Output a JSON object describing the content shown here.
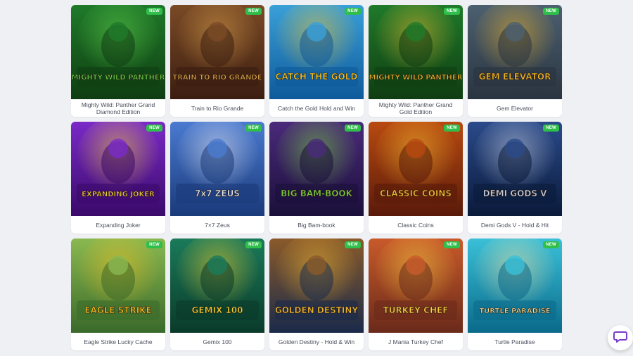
{
  "games": [
    {
      "title": "Mighty Wild: Panther Grand Diamond Edition",
      "badge": "NEW",
      "art_title": "MIGHTY WILD PANTHER",
      "colors": [
        "#0f3d12",
        "#1f7a2a",
        "#62d04a"
      ]
    },
    {
      "title": "Train to Rio Grande",
      "badge": "NEW",
      "art_title": "TRAIN TO RIO GRANDE",
      "colors": [
        "#3b1d10",
        "#7a4a26",
        "#d8a04a"
      ]
    },
    {
      "title": "Catch the Gold Hold and Win",
      "badge": "NEW",
      "art_title": "CATCH THE GOLD",
      "colors": [
        "#0e5a9a",
        "#3aa0d8",
        "#f2c530"
      ]
    },
    {
      "title": "Mighty Wild: Panther Grand Gold Edition",
      "badge": "NEW",
      "art_title": "MIGHTY WILD PANTHER",
      "colors": [
        "#0f3d12",
        "#1f7a2a",
        "#e8b830"
      ]
    },
    {
      "title": "Gem Elevator",
      "badge": "NEW",
      "art_title": "GEM ELEVATOR",
      "colors": [
        "#2a3440",
        "#4c6070",
        "#f0b428"
      ]
    },
    {
      "title": "Expanding Joker",
      "badge": "NEW",
      "art_title": "EXPANDING JOKER",
      "colors": [
        "#3a0a6a",
        "#7a2ac8",
        "#f4d040"
      ]
    },
    {
      "title": "7×7 Zeus",
      "badge": "NEW",
      "art_title": "7x7 ZEUS",
      "colors": [
        "#1a3a7a",
        "#4a7ad0",
        "#e8e8f0"
      ]
    },
    {
      "title": "Big Bam-book",
      "badge": "NEW",
      "art_title": "BIG BAM-BOOK",
      "colors": [
        "#1a0f3a",
        "#4a2a7a",
        "#7ad040"
      ]
    },
    {
      "title": "Classic Coins",
      "badge": "NEW",
      "art_title": "CLASSIC COINS",
      "colors": [
        "#5a1a0a",
        "#b84a10",
        "#f8c030"
      ]
    },
    {
      "title": "Demi Gods V - Hold & Hit",
      "badge": "NEW",
      "art_title": "DEMI GODS V",
      "colors": [
        "#0a1a3a",
        "#2a4a8a",
        "#c8d0e0"
      ]
    },
    {
      "title": "Eagle Strike Lucky Cache",
      "badge": "NEW",
      "art_title": "EAGLE STRIKE",
      "colors": [
        "#3a6a2a",
        "#8ab850",
        "#f4c020"
      ]
    },
    {
      "title": "Gemix 100",
      "badge": "NEW",
      "art_title": "GEMIX 100",
      "colors": [
        "#0a3a2a",
        "#1a7a5a",
        "#f0d030"
      ]
    },
    {
      "title": "Golden Destiny - Hold & Win",
      "badge": "NEW",
      "art_title": "GOLDEN DESTINY",
      "colors": [
        "#1a2a4a",
        "#8a5a2a",
        "#f0b830"
      ]
    },
    {
      "title": "J Mania Turkey Chef",
      "badge": "NEW",
      "art_title": "TURKEY CHEF",
      "colors": [
        "#6a2a1a",
        "#c85a2a",
        "#f8d040"
      ]
    },
    {
      "title": "Turtle Paradise",
      "badge": "NEW",
      "art_title": "TURTLE PARADISE",
      "colors": [
        "#0a6a8a",
        "#3ac0d8",
        "#f4e0a0"
      ]
    }
  ],
  "chat": {
    "icon": "chat-bubble-icon",
    "color": "#7a3ac8"
  }
}
